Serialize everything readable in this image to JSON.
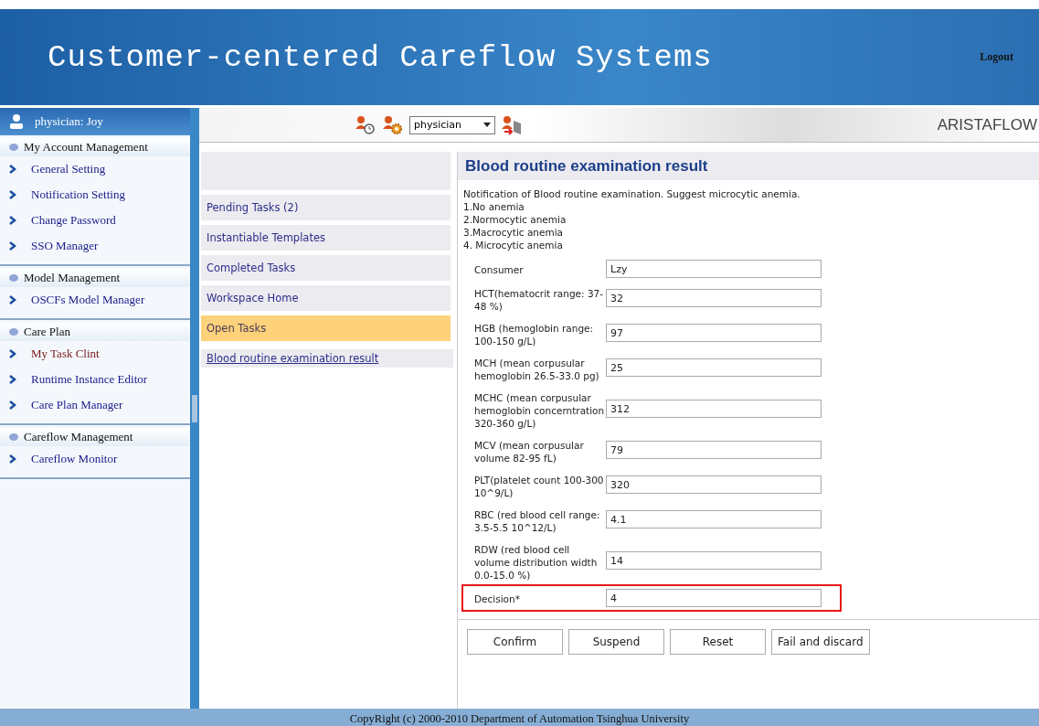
{
  "header": {
    "title": "Customer-centered Careflow Systems",
    "logout": "Logout"
  },
  "sidebar": {
    "user": "physician: Joy",
    "groups": [
      {
        "title": "My Account Management",
        "items": [
          {
            "label": "General Setting",
            "selected": false
          },
          {
            "label": "Notification Setting",
            "selected": false
          },
          {
            "label": "Change Password",
            "selected": false
          },
          {
            "label": "SSO Manager",
            "selected": false
          }
        ]
      },
      {
        "title": "Model Management",
        "items": [
          {
            "label": "OSCFs Model Manager",
            "selected": false
          }
        ]
      },
      {
        "title": "Care Plan",
        "items": [
          {
            "label": "My Task Clint",
            "selected": true
          },
          {
            "label": "Runtime Instance Editor",
            "selected": false
          },
          {
            "label": "Care Plan Manager",
            "selected": false
          }
        ]
      },
      {
        "title": "Careflow Management",
        "items": [
          {
            "label": "Careflow Monitor",
            "selected": false
          }
        ]
      }
    ]
  },
  "toolbar": {
    "role": "physician",
    "brand": "ARISTAFLOW"
  },
  "tasks": [
    {
      "label": "Pending Tasks (2)",
      "selected": false
    },
    {
      "label": "Instantiable Templates",
      "selected": false
    },
    {
      "label": "Completed Tasks",
      "selected": false
    },
    {
      "label": "Workspace Home",
      "selected": false
    },
    {
      "label": "Open Tasks",
      "selected": true
    }
  ],
  "task_link": "Blood routine examination result",
  "form": {
    "title": "Blood routine examination result",
    "notes": [
      "Notification of Blood routine examination. Suggest microcytic anemia.",
      "1.No anemia",
      "2.Normocytic anemia",
      "3.Macrocytic anemia",
      "4. Microcytic anemia"
    ],
    "fields": [
      {
        "label": "Consumer",
        "value": "Lzy",
        "highlighted": false
      },
      {
        "label": "HCT(hematocrit range: 37-48 %)",
        "value": "32",
        "highlighted": false
      },
      {
        "label": "HGB (hemoglobin range: 100-150 g/L)",
        "value": "97",
        "highlighted": false
      },
      {
        "label": "MCH (mean corpusular hemoglobin 26.5-33.0 pg)",
        "value": "25",
        "highlighted": false
      },
      {
        "label": "MCHC (mean corpusular hemoglobin concerntration 320-360 g/L)",
        "value": "312",
        "highlighted": false
      },
      {
        "label": "MCV (mean corpusular volume 82-95 fL)",
        "value": "79",
        "highlighted": false
      },
      {
        "label": "PLT(platelet count 100-300 10^9/L)",
        "value": "320",
        "highlighted": false
      },
      {
        "label": "RBC (red blood cell range: 3.5-5.5 10^12/L)",
        "value": "4.1",
        "highlighted": false
      },
      {
        "label": "RDW (red blood cell volume distribution width 0.0-15.0 %)",
        "value": "14",
        "highlighted": false
      },
      {
        "label": "Decision*",
        "value": "4",
        "highlighted": true
      }
    ],
    "buttons": [
      "Confirm",
      "Suspend",
      "Reset",
      "Fail and discard"
    ]
  },
  "footer": "CopyRight (c) 2000-2010 Department of Automation Tsinghua University"
}
